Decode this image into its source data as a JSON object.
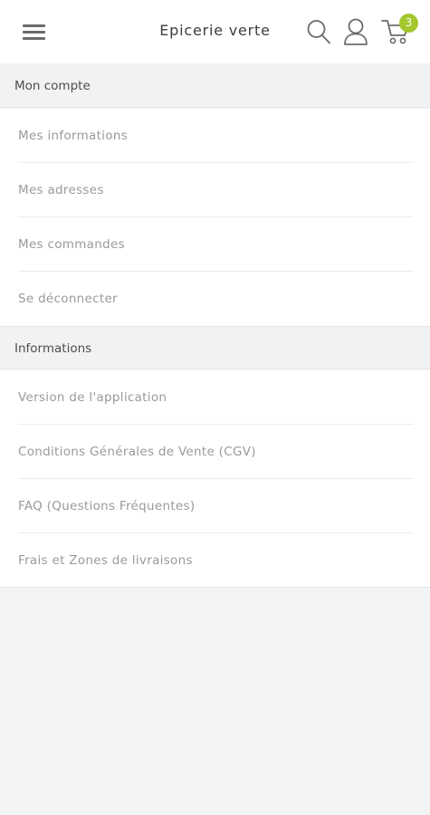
{
  "header": {
    "title": "Epicerie verte",
    "menu_icon": "hamburger-menu-icon",
    "search_icon": "search-icon",
    "account_icon": "user-icon",
    "cart_icon": "cart-icon",
    "cart_count": "3",
    "accent_color": "#a3c82d"
  },
  "sections": [
    {
      "title": "Mon compte",
      "items": [
        {
          "label": "Mes informations"
        },
        {
          "label": "Mes adresses"
        },
        {
          "label": "Mes commandes"
        },
        {
          "label": "Se déconnecter"
        }
      ]
    },
    {
      "title": "Informations",
      "items": [
        {
          "label": "Version de l'application"
        },
        {
          "label": "Conditions Générales de Vente (CGV)"
        },
        {
          "label": "FAQ (Questions Fréquentes)"
        },
        {
          "label": "Frais et Zones de livraisons"
        }
      ]
    }
  ]
}
